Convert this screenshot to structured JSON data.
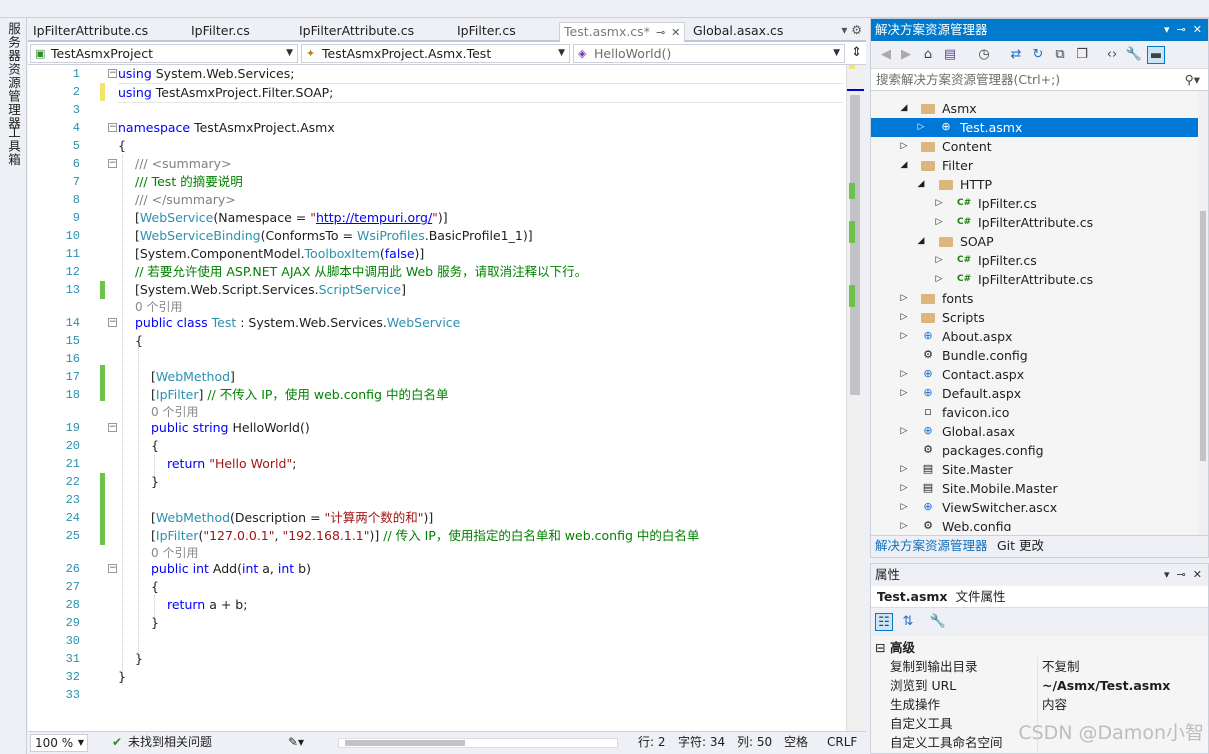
{
  "left_rail": {
    "item1": "服务器资源管理器",
    "item2": "工具箱"
  },
  "tabs": [
    "IpFilterAttribute.cs",
    "IpFilter.cs",
    "IpFilterAttribute.cs",
    "IpFilter.cs",
    "Test.asmx.cs*",
    "Global.asax.cs"
  ],
  "nav": {
    "project": "TestAsmxProject",
    "class": "TestAsmxProject.Asmx.Test",
    "member": "HelloWorld()"
  },
  "code": {
    "l1": [
      "using",
      " System.Web.Services;"
    ],
    "l2": [
      "using",
      " TestAsmxProject.Filter.SOAP;"
    ],
    "l4": [
      "namespace",
      " TestAsmxProject.Asmx"
    ],
    "l5": "{",
    "l6": [
      "///",
      " <summary>"
    ],
    "l7": "/// Test 的摘要说明",
    "l8": [
      "///",
      " </summary>"
    ],
    "l9": [
      "[",
      "WebService",
      "(Namespace = ",
      "\"",
      "http://tempuri.org/",
      "\"",
      ")]"
    ],
    "l10": [
      "[",
      "WebServiceBinding",
      "(ConformsTo = ",
      "WsiProfiles",
      ".BasicProfile1_1)]"
    ],
    "l11": [
      "[System.ComponentModel.",
      "ToolboxItem",
      "(",
      "false",
      ")]"
    ],
    "l12": "// 若要允许使用 ASP.NET AJAX 从脚本中调用此 Web 服务，请取消注释以下行。",
    "l13": [
      "[System.Web.Script.Services.",
      "ScriptService",
      "]"
    ],
    "ref1": "0 个引用",
    "l14": [
      "public",
      " ",
      "class",
      " ",
      "Test",
      " : System.Web.Services.",
      "WebService"
    ],
    "l15": "{",
    "l17": [
      "[",
      "WebMethod",
      "]"
    ],
    "l18": [
      "[",
      "IpFilter",
      "] ",
      "// 不传入 IP，使用 web.config 中的白名单"
    ],
    "ref2": "0 个引用",
    "l19": [
      "public",
      " ",
      "string",
      " HelloWorld()"
    ],
    "l20": "{",
    "l21": [
      "return",
      " ",
      "\"Hello World\"",
      ";"
    ],
    "l22": "}",
    "l24": [
      "[",
      "WebMethod",
      "(Description = ",
      "\"计算两个数的和\"",
      ")]"
    ],
    "l25": [
      "[",
      "IpFilter",
      "(",
      "\"127.0.0.1\"",
      ", ",
      "\"192.168.1.1\"",
      ")] ",
      "// 传入 IP，使用指定的白名单和 web.config 中的白名单"
    ],
    "ref3": "0 个引用",
    "l26": [
      "public",
      " ",
      "int",
      " Add(",
      "int",
      " a, ",
      "int",
      " b)"
    ],
    "l27": "{",
    "l28": [
      "return",
      " a + b;"
    ],
    "l29": "}",
    "l31": "}",
    "l32": "}"
  },
  "status": {
    "zoom": "100 %",
    "issues": "未找到相关问题",
    "line": "行: 2",
    "char": "字符: 34",
    "col": "列: 50",
    "indent": "空格",
    "eol": "CRLF"
  },
  "solution": {
    "title": "解决方案资源管理器",
    "search_placeholder": "搜索解决方案资源管理器(Ctrl+;)",
    "nodes": [
      "Asmx",
      "Test.asmx",
      "Content",
      "Filter",
      "HTTP",
      "IpFilter.cs",
      "IpFilterAttribute.cs",
      "SOAP",
      "IpFilter.cs",
      "IpFilterAttribute.cs",
      "fonts",
      "Scripts",
      "About.aspx",
      "Bundle.config",
      "Contact.aspx",
      "Default.aspx",
      "favicon.ico",
      "Global.asax",
      "packages.config",
      "Site.Master",
      "Site.Mobile.Master",
      "ViewSwitcher.ascx",
      "Web.config"
    ],
    "tab_active": "解决方案资源管理器",
    "tab_other": "Git 更改"
  },
  "properties": {
    "title": "属性",
    "object": "Test.asmx",
    "object_type": "文件属性",
    "category": "高级",
    "rows": [
      {
        "k": "复制到输出目录",
        "v": "不复制"
      },
      {
        "k": "浏览到 URL",
        "v": "~/Asmx/Test.asmx"
      },
      {
        "k": "生成操作",
        "v": "内容"
      },
      {
        "k": "自定义工具",
        "v": ""
      },
      {
        "k": "自定义工具命名空间",
        "v": ""
      }
    ]
  },
  "watermark": "CSDN @Damon小智",
  "colors": {
    "accent": "#007acc",
    "selection": "#0078d7",
    "change_bar": "#6cc24a",
    "keyword": "#0000ff",
    "type": "#2b91af",
    "comment": "#008000",
    "string": "#a31515"
  }
}
